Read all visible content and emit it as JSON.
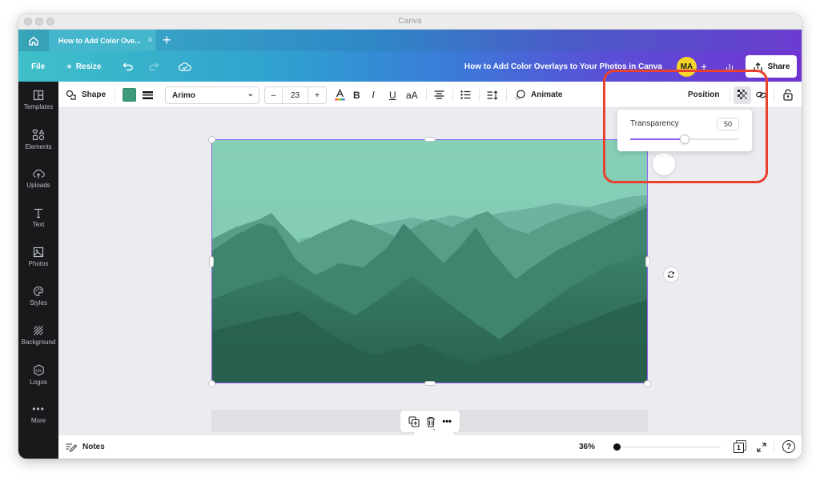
{
  "window": {
    "title": "Canva"
  },
  "tabs": {
    "home_icon": "home-icon",
    "active_tab": {
      "label": "How to Add Color Ove...",
      "close": "×"
    },
    "new_tab": "+"
  },
  "menubar": {
    "file": "File",
    "resize": "Resize",
    "resize_icon": "✳",
    "doc_title": "How to Add Color Overlays to Your Photos in Canva",
    "avatar_initials": "MA",
    "add_collaborator": "+",
    "share": "Share"
  },
  "sidebar": {
    "items": [
      {
        "label": "Templates",
        "icon": "templates-icon"
      },
      {
        "label": "Elements",
        "icon": "elements-icon"
      },
      {
        "label": "Uploads",
        "icon": "uploads-icon"
      },
      {
        "label": "Text",
        "icon": "text-icon"
      },
      {
        "label": "Photos",
        "icon": "photos-icon"
      },
      {
        "label": "Styles",
        "icon": "styles-icon"
      },
      {
        "label": "Background",
        "icon": "background-icon"
      },
      {
        "label": "Logos",
        "icon": "logos-icon"
      },
      {
        "label": "More",
        "icon": "more-icon"
      }
    ]
  },
  "toolbar": {
    "shape_label": "Shape",
    "fill_color": "#3d9a78",
    "font": "Arimo",
    "font_size": "23",
    "decrease": "–",
    "increase": "+",
    "bold": "B",
    "italic": "I",
    "underline": "U",
    "case": "aA",
    "animate": "Animate",
    "position": "Position"
  },
  "transparency": {
    "label": "Transparency",
    "value": "50",
    "percent": 50
  },
  "bottombar": {
    "notes": "Notes",
    "zoom": "36%",
    "zoom_fraction": 0.04,
    "page_number": "1"
  },
  "colors": {
    "accent": "#8b5cf6",
    "highlight": "#e8422f",
    "overlay_top": "#86cfb9",
    "overlay_bottom": "#27604c"
  }
}
